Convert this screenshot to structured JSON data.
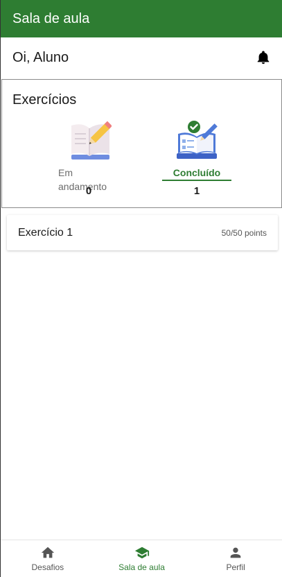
{
  "app_bar": {
    "title": "Sala de aula"
  },
  "header": {
    "greeting": "Oi, Aluno",
    "notification_icon": "bell-icon"
  },
  "exercises": {
    "title": "Exercícios",
    "stats": [
      {
        "label": "Em andamento",
        "count": "0",
        "icon": "open-book-pencil-illustration",
        "active": false
      },
      {
        "label": "Concluído",
        "count": "1",
        "icon": "checked-book-illustration",
        "active": true
      }
    ]
  },
  "exercise_list": [
    {
      "name": "Exercício 1",
      "points": "50/50 points"
    }
  ],
  "bottom_nav": {
    "items": [
      {
        "label": "Desafios",
        "icon": "home-icon",
        "active": false
      },
      {
        "label": "Sala de aula",
        "icon": "graduation-cap-icon",
        "active": true
      },
      {
        "label": "Perfil",
        "icon": "person-icon",
        "active": false
      }
    ]
  },
  "colors": {
    "primary": "#2e7d32",
    "text": "#1a1a1a",
    "muted": "#6b6b6b"
  }
}
